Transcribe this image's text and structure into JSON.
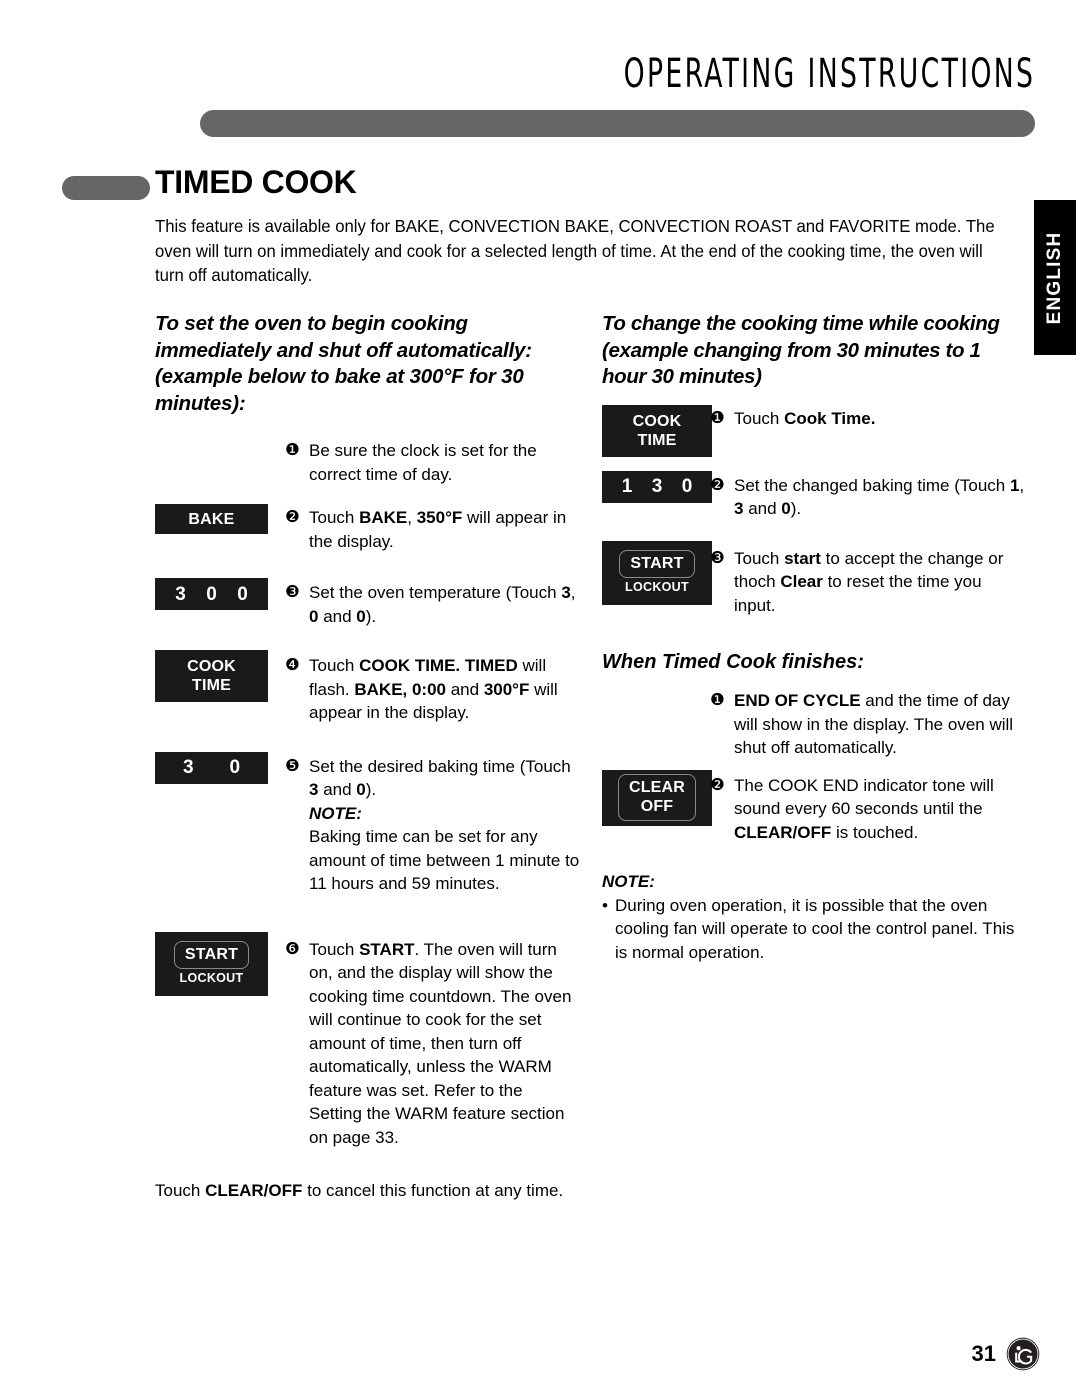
{
  "header": {
    "title": "OPERATING INSTRUCTIONS",
    "language_tab": "ENGLISH"
  },
  "section": {
    "title": "TIMED COOK",
    "intro": "This feature is available only for BAKE, CONVECTION BAKE, CONVECTION ROAST and FAVORITE mode. The oven will turn on immediately and cook for a selected length of time. At the end of the cooking time, the oven will turn off automatically."
  },
  "left_column": {
    "heading": "To set the oven to begin cooking immediately and shut off automatically: (example below to bake at 300°F for 30 minutes):",
    "steps": [
      {
        "marker": "❶",
        "text": "Be sure the clock is set for the correct time of day.",
        "key": null
      },
      {
        "marker": "❷",
        "text_html": "Touch <b>BAKE</b>, <b>350°F</b> will appear in the display.",
        "key": {
          "type": "label",
          "label": "BAKE"
        }
      },
      {
        "marker": "❸",
        "text_html": "Set the oven temperature (Touch <b>3</b>, <b>0</b> and <b>0</b>).",
        "key": {
          "type": "digits",
          "digits": [
            "3",
            "0",
            "0"
          ]
        }
      },
      {
        "marker": "❹",
        "text_html": "Touch <b>COOK TIME. TIMED</b> will flash. <b>BAKE, 0:00</b> and <b>300°F</b> will appear in the display.",
        "key": {
          "type": "label2",
          "line1": "COOK",
          "line2": "TIME"
        }
      },
      {
        "marker": "❺",
        "text_html": "Set the desired baking time (Touch <b>3</b> and <b>0</b>).",
        "key": {
          "type": "digits",
          "digits": [
            "3",
            "0"
          ]
        },
        "note_title": "NOTE:",
        "note_text": "Baking time can be set for any amount of time between 1 minute to 11 hours and 59 minutes."
      },
      {
        "marker": "❻",
        "text_html": "Touch <b>START</b>. The oven will turn on, and the display will show the cooking time countdown. The oven will continue to cook for the set amount of time, then turn off automatically, unless the WARM feature was set. Refer to the Setting the WARM feature section on page 33.",
        "key": {
          "type": "outline",
          "label": "START",
          "sub": "LOCKOUT"
        }
      }
    ],
    "closing_html": "Touch <b>CLEAR/OFF</b> to cancel this function at any time."
  },
  "right_column": {
    "heading": "To change the cooking time while cooking (example changing from 30 minutes to 1 hour 30 minutes)",
    "steps": [
      {
        "marker": "❶",
        "text_html": "Touch <b>Cook Time.</b>",
        "key": {
          "type": "label2",
          "line1": "COOK",
          "line2": "TIME"
        }
      },
      {
        "marker": "❷",
        "text_html": "Set the changed baking time (Touch <b>1</b>, <b>3</b> and <b>0</b>).",
        "key": {
          "type": "digits",
          "digits": [
            "1",
            "3",
            "0"
          ]
        }
      },
      {
        "marker": "❸",
        "text_html": "Touch <b>start</b> to accept the change or thoch <b>Clear</b> to reset the time you input.",
        "key": {
          "type": "outline",
          "label": "START",
          "sub": "LOCKOUT"
        }
      }
    ],
    "finish_heading": "When Timed Cook finishes:",
    "finish_steps": [
      {
        "marker": "❶",
        "text_html": "<b>END OF CYCLE</b> and the time of day will show in the display. The oven will shut off automatically.",
        "key": null
      },
      {
        "marker": "❷",
        "text_html": "The COOK END indicator tone will sound every 60 seconds until the <b>CLEAR/OFF</b> is touched.",
        "key": {
          "type": "outline2",
          "line1": "CLEAR",
          "line2": "OFF"
        }
      }
    ],
    "note_title": "NOTE:",
    "note_bullet": "•",
    "note_text": "During oven operation, it is possible that the oven cooling fan will operate to cool the control panel. This is normal operation."
  },
  "footer": {
    "page_number": "31",
    "logo_text": "LG"
  },
  "colors": {
    "bar_gray": "#666666",
    "key_black": "#1a1a1a",
    "key_outline": "#8a8a8a",
    "text": "#000000"
  }
}
